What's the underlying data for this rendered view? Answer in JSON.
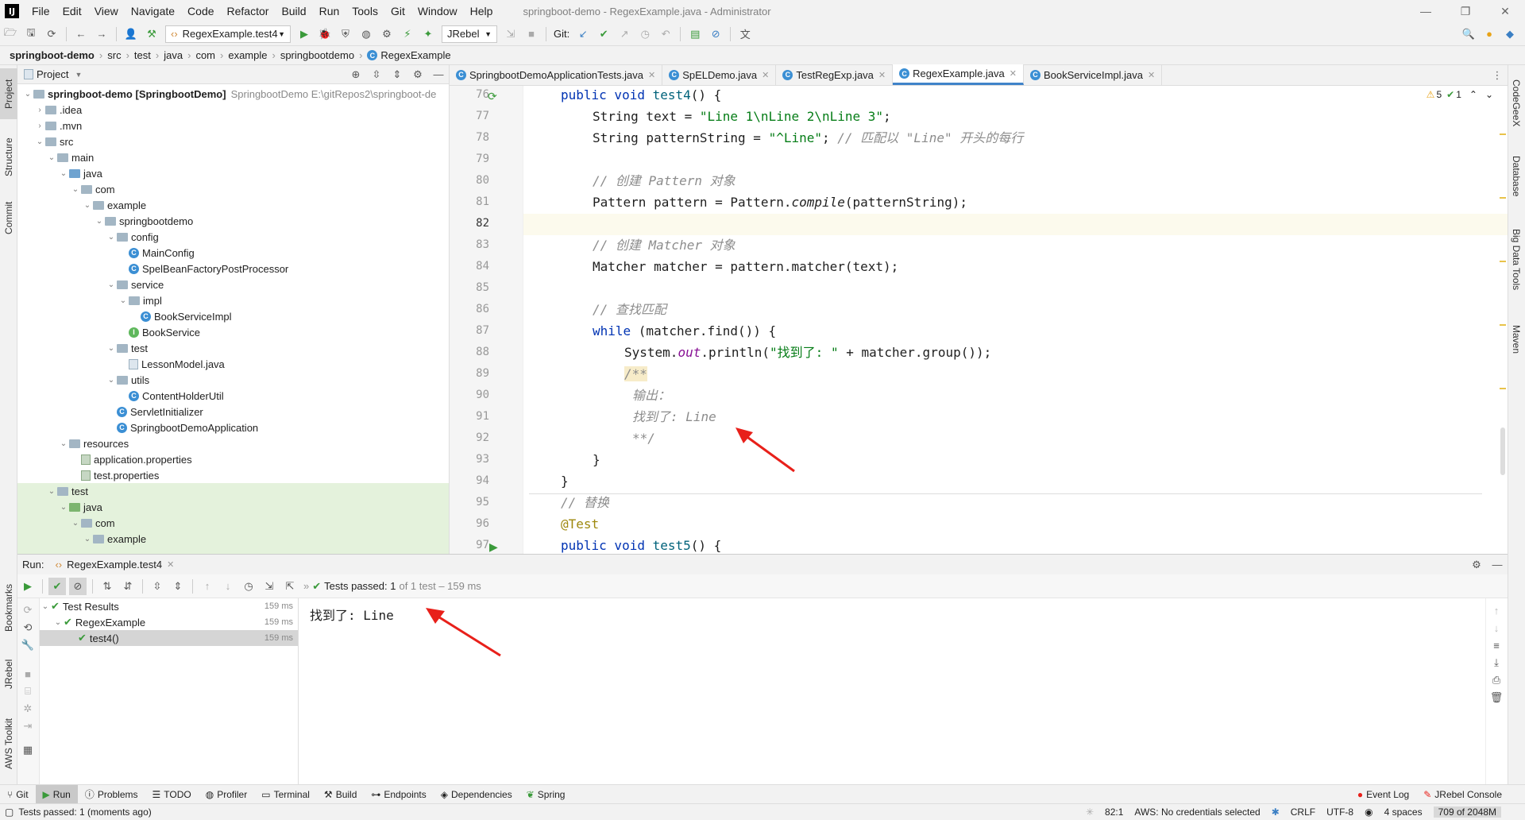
{
  "window": {
    "menu": [
      "File",
      "Edit",
      "View",
      "Navigate",
      "Code",
      "Refactor",
      "Build",
      "Run",
      "Tools",
      "Git",
      "Window",
      "Help"
    ],
    "title": "springboot-demo - RegexExample.java - Administrator"
  },
  "toolbar": {
    "run_config": "RegexExample.test4",
    "jrebel": "JRebel",
    "git_label": "Git:"
  },
  "breadcrumb": [
    "springboot-demo",
    "src",
    "test",
    "java",
    "com",
    "example",
    "springbootdemo",
    "RegexExample"
  ],
  "left_tabs": [
    "Project",
    "Structure",
    "Commit",
    "Bookmarks",
    "JRebel",
    "AWS Toolkit"
  ],
  "right_tabs": [
    "CodeGeeX",
    "Database",
    "Big Data Tools",
    "Maven"
  ],
  "project": {
    "header": "Project",
    "tree": [
      {
        "label": "springboot-demo [SpringbootDemo]",
        "extra": "SpringbootDemo  E:\\gitRepos2\\springboot-de",
        "depth": 0,
        "icon": "folder",
        "open": true
      },
      {
        "label": ".idea",
        "depth": 1,
        "icon": "folder",
        "open": false
      },
      {
        "label": ".mvn",
        "depth": 1,
        "icon": "folder",
        "open": false
      },
      {
        "label": "src",
        "depth": 1,
        "icon": "folder",
        "open": true
      },
      {
        "label": "main",
        "depth": 2,
        "icon": "folder",
        "open": true
      },
      {
        "label": "java",
        "depth": 3,
        "icon": "folder-blue",
        "open": true
      },
      {
        "label": "com",
        "depth": 4,
        "icon": "folder",
        "open": true
      },
      {
        "label": "example",
        "depth": 5,
        "icon": "folder",
        "open": true
      },
      {
        "label": "springbootdemo",
        "depth": 6,
        "icon": "folder",
        "open": true
      },
      {
        "label": "config",
        "depth": 7,
        "icon": "folder",
        "open": true
      },
      {
        "label": "MainConfig",
        "depth": 8,
        "icon": "class"
      },
      {
        "label": "SpelBeanFactoryPostProcessor",
        "depth": 8,
        "icon": "class"
      },
      {
        "label": "service",
        "depth": 7,
        "icon": "folder",
        "open": true
      },
      {
        "label": "impl",
        "depth": 8,
        "icon": "folder",
        "open": true
      },
      {
        "label": "BookServiceImpl",
        "depth": 9,
        "icon": "class"
      },
      {
        "label": "BookService",
        "depth": 8,
        "icon": "interface"
      },
      {
        "label": "test",
        "depth": 7,
        "icon": "folder",
        "open": true
      },
      {
        "label": "LessonModel.java",
        "depth": 8,
        "icon": "file"
      },
      {
        "label": "utils",
        "depth": 7,
        "icon": "folder",
        "open": true
      },
      {
        "label": "ContentHolderUtil",
        "depth": 8,
        "icon": "class"
      },
      {
        "label": "ServletInitializer",
        "depth": 7,
        "icon": "class"
      },
      {
        "label": "SpringbootDemoApplication",
        "depth": 7,
        "icon": "class"
      },
      {
        "label": "resources",
        "depth": 3,
        "icon": "folder",
        "open": true
      },
      {
        "label": "application.properties",
        "depth": 4,
        "icon": "prop"
      },
      {
        "label": "test.properties",
        "depth": 4,
        "icon": "prop"
      },
      {
        "label": "test",
        "depth": 2,
        "icon": "folder",
        "open": true,
        "hl": true
      },
      {
        "label": "java",
        "depth": 3,
        "icon": "folder-green",
        "open": true,
        "hl": true
      },
      {
        "label": "com",
        "depth": 4,
        "icon": "folder",
        "open": true,
        "hl": true
      },
      {
        "label": "example",
        "depth": 5,
        "icon": "folder",
        "open": true,
        "hl": true
      }
    ]
  },
  "editor": {
    "tabs": [
      {
        "label": "SpringbootDemoApplicationTests.java",
        "active": false
      },
      {
        "label": "SpELDemo.java",
        "active": false
      },
      {
        "label": "TestRegExp.java",
        "active": false
      },
      {
        "label": "RegexExample.java",
        "active": true
      },
      {
        "label": "BookServiceImpl.java",
        "active": false
      }
    ],
    "inspections": {
      "warnings": "5",
      "ok": "1"
    },
    "line_numbers": [
      "76",
      "77",
      "78",
      "79",
      "80",
      "81",
      "82",
      "83",
      "84",
      "85",
      "86",
      "87",
      "88",
      "89",
      "90",
      "91",
      "92",
      "93",
      "94",
      "95",
      "96",
      "97"
    ]
  },
  "run": {
    "label": "Run:",
    "tab": "RegexExample.test4",
    "status": "Tests passed: 1",
    "status_detail": "of 1 test – 159 ms",
    "tests": [
      {
        "label": "Test Results",
        "ms": "159 ms",
        "depth": 0
      },
      {
        "label": "RegexExample",
        "ms": "159 ms",
        "depth": 1
      },
      {
        "label": "test4()",
        "ms": "159 ms",
        "depth": 2,
        "selected": true
      }
    ],
    "console_output": "找到了: Line"
  },
  "bottom_tabs": [
    "Git",
    "Run",
    "Problems",
    "TODO",
    "Profiler",
    "Terminal",
    "Build",
    "Endpoints",
    "Dependencies",
    "Spring"
  ],
  "bottom_right": [
    "Event Log",
    "JRebel Console"
  ],
  "status": {
    "message": "Tests passed: 1 (moments ago)",
    "position": "82:1",
    "aws": "AWS: No credentials selected",
    "line_sep": "CRLF",
    "encoding": "UTF-8",
    "indent": "4 spaces",
    "memory": "709 of 2048M"
  },
  "colors": {
    "accent": "#4083c9",
    "pass": "#3a9a3a",
    "arrow": "#e8201a"
  }
}
